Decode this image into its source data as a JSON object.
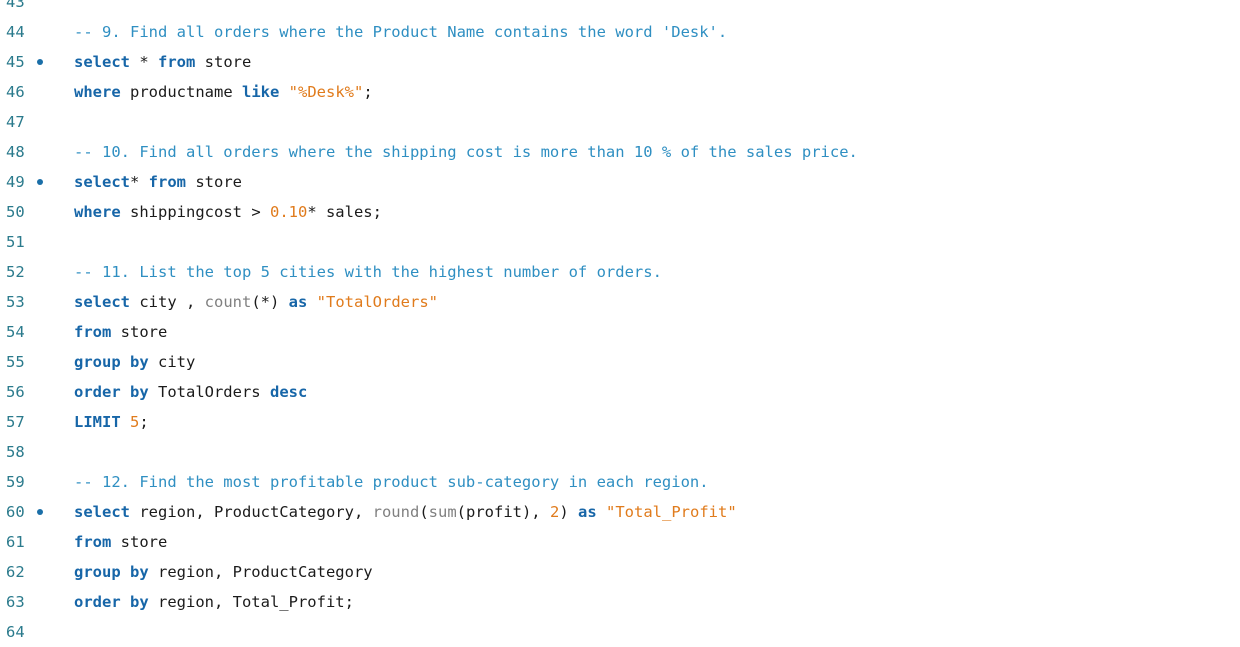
{
  "editor": {
    "lines": [
      {
        "num": "43",
        "tokens": []
      },
      {
        "num": "44",
        "tokens": [
          {
            "t": "-- 9. Find all orders where the Product Name contains the word 'Desk'.",
            "c": "cm"
          }
        ]
      },
      {
        "num": "45",
        "breakpoint": true,
        "tokens": [
          {
            "t": "select",
            "c": "kw"
          },
          {
            "t": " * ",
            "c": ""
          },
          {
            "t": "from",
            "c": "kw"
          },
          {
            "t": " store",
            "c": ""
          }
        ]
      },
      {
        "num": "46",
        "tokens": [
          {
            "t": "where",
            "c": "kw"
          },
          {
            "t": " productname ",
            "c": ""
          },
          {
            "t": "like",
            "c": "kw"
          },
          {
            "t": " ",
            "c": ""
          },
          {
            "t": "\"%Desk%\"",
            "c": "st"
          },
          {
            "t": ";",
            "c": ""
          }
        ]
      },
      {
        "num": "47",
        "tokens": []
      },
      {
        "num": "48",
        "tokens": [
          {
            "t": "-- 10. Find all orders where the shipping cost is more than 10 % of the sales price.",
            "c": "cm"
          }
        ]
      },
      {
        "num": "49",
        "breakpoint": true,
        "tokens": [
          {
            "t": "select",
            "c": "kw"
          },
          {
            "t": "* ",
            "c": ""
          },
          {
            "t": "from",
            "c": "kw"
          },
          {
            "t": " store",
            "c": ""
          }
        ]
      },
      {
        "num": "50",
        "tokens": [
          {
            "t": "where",
            "c": "kw"
          },
          {
            "t": " shippingcost > ",
            "c": ""
          },
          {
            "t": "0.10",
            "c": "nm"
          },
          {
            "t": "* sales;",
            "c": ""
          }
        ]
      },
      {
        "num": "51",
        "tokens": []
      },
      {
        "num": "52",
        "tokens": [
          {
            "t": "-- 11. List the top 5 cities with the highest number of orders.",
            "c": "cm"
          }
        ]
      },
      {
        "num": "53",
        "tokens": [
          {
            "t": "select",
            "c": "kw"
          },
          {
            "t": " city , ",
            "c": ""
          },
          {
            "t": "count",
            "c": "fn"
          },
          {
            "t": "(*) ",
            "c": ""
          },
          {
            "t": "as",
            "c": "kw"
          },
          {
            "t": " ",
            "c": ""
          },
          {
            "t": "\"TotalOrders\"",
            "c": "st"
          }
        ]
      },
      {
        "num": "54",
        "tokens": [
          {
            "t": "from",
            "c": "kw"
          },
          {
            "t": " store",
            "c": ""
          }
        ]
      },
      {
        "num": "55",
        "tokens": [
          {
            "t": "group by",
            "c": "kw"
          },
          {
            "t": " city",
            "c": ""
          }
        ]
      },
      {
        "num": "56",
        "tokens": [
          {
            "t": "order by",
            "c": "kw"
          },
          {
            "t": " TotalOrders ",
            "c": ""
          },
          {
            "t": "desc",
            "c": "kw"
          }
        ]
      },
      {
        "num": "57",
        "tokens": [
          {
            "t": "LIMIT",
            "c": "kw"
          },
          {
            "t": " ",
            "c": ""
          },
          {
            "t": "5",
            "c": "nm"
          },
          {
            "t": ";",
            "c": ""
          }
        ]
      },
      {
        "num": "58",
        "tokens": []
      },
      {
        "num": "59",
        "tokens": [
          {
            "t": "-- 12. Find the most profitable product sub-category in each region.",
            "c": "cm"
          }
        ]
      },
      {
        "num": "60",
        "breakpoint": true,
        "tokens": [
          {
            "t": "select",
            "c": "kw"
          },
          {
            "t": " region, ProductCategory, ",
            "c": ""
          },
          {
            "t": "round",
            "c": "fn"
          },
          {
            "t": "(",
            "c": ""
          },
          {
            "t": "sum",
            "c": "fn"
          },
          {
            "t": "(profit), ",
            "c": ""
          },
          {
            "t": "2",
            "c": "nm"
          },
          {
            "t": ") ",
            "c": ""
          },
          {
            "t": "as",
            "c": "kw"
          },
          {
            "t": " ",
            "c": ""
          },
          {
            "t": "\"Total_Profit\"",
            "c": "st"
          }
        ]
      },
      {
        "num": "61",
        "tokens": [
          {
            "t": "from",
            "c": "kw"
          },
          {
            "t": " store",
            "c": ""
          }
        ]
      },
      {
        "num": "62",
        "tokens": [
          {
            "t": "group by",
            "c": "kw"
          },
          {
            "t": " region, ProductCategory",
            "c": ""
          }
        ]
      },
      {
        "num": "63",
        "tokens": [
          {
            "t": "order by",
            "c": "kw"
          },
          {
            "t": " region, Total_Profit;",
            "c": ""
          }
        ]
      },
      {
        "num": "64",
        "tokens": []
      }
    ]
  }
}
